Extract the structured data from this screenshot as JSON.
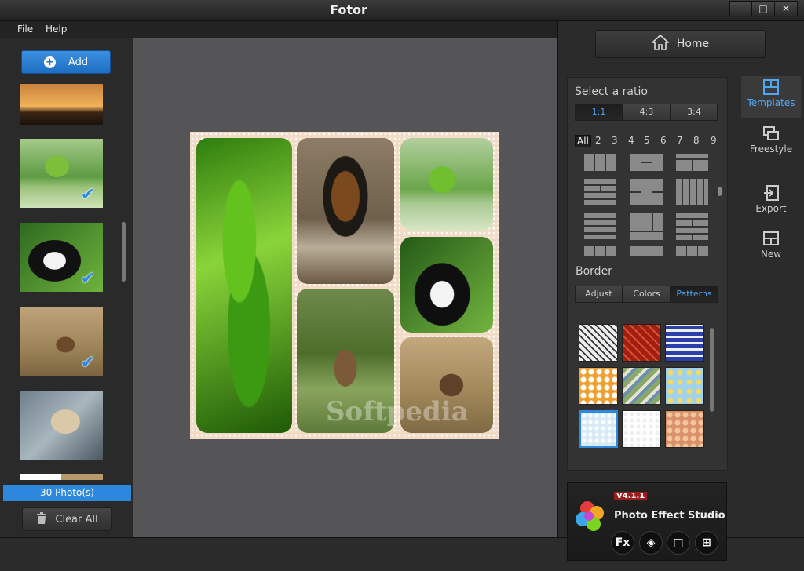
{
  "window": {
    "title": "Fotor"
  },
  "menu": {
    "file": "File",
    "help": "Help"
  },
  "left": {
    "add_label": "Add",
    "photo_count": "30 Photo(s)",
    "clear_label": "Clear All"
  },
  "canvas": {
    "watermark": "Softpedia"
  },
  "right": {
    "home_label": "Home",
    "ratio_title": "Select a ratio",
    "ratios": [
      "1:1",
      "4:3",
      "3:4"
    ],
    "numbers": [
      "All",
      "2",
      "3",
      "4",
      "5",
      "6",
      "7",
      "8",
      "9"
    ],
    "border_title": "Border",
    "border_tabs": [
      "Adjust",
      "Colors",
      "Patterns"
    ]
  },
  "tools": {
    "templates": "Templates",
    "freestyle": "Freestyle",
    "export": "Export",
    "new": "New"
  },
  "promo": {
    "version": "V4.1.1",
    "title": "Photo Effect Studio",
    "fx": "Fx"
  },
  "colors": {
    "accent": "#2e88dd",
    "active_text": "#4fa6f5"
  }
}
